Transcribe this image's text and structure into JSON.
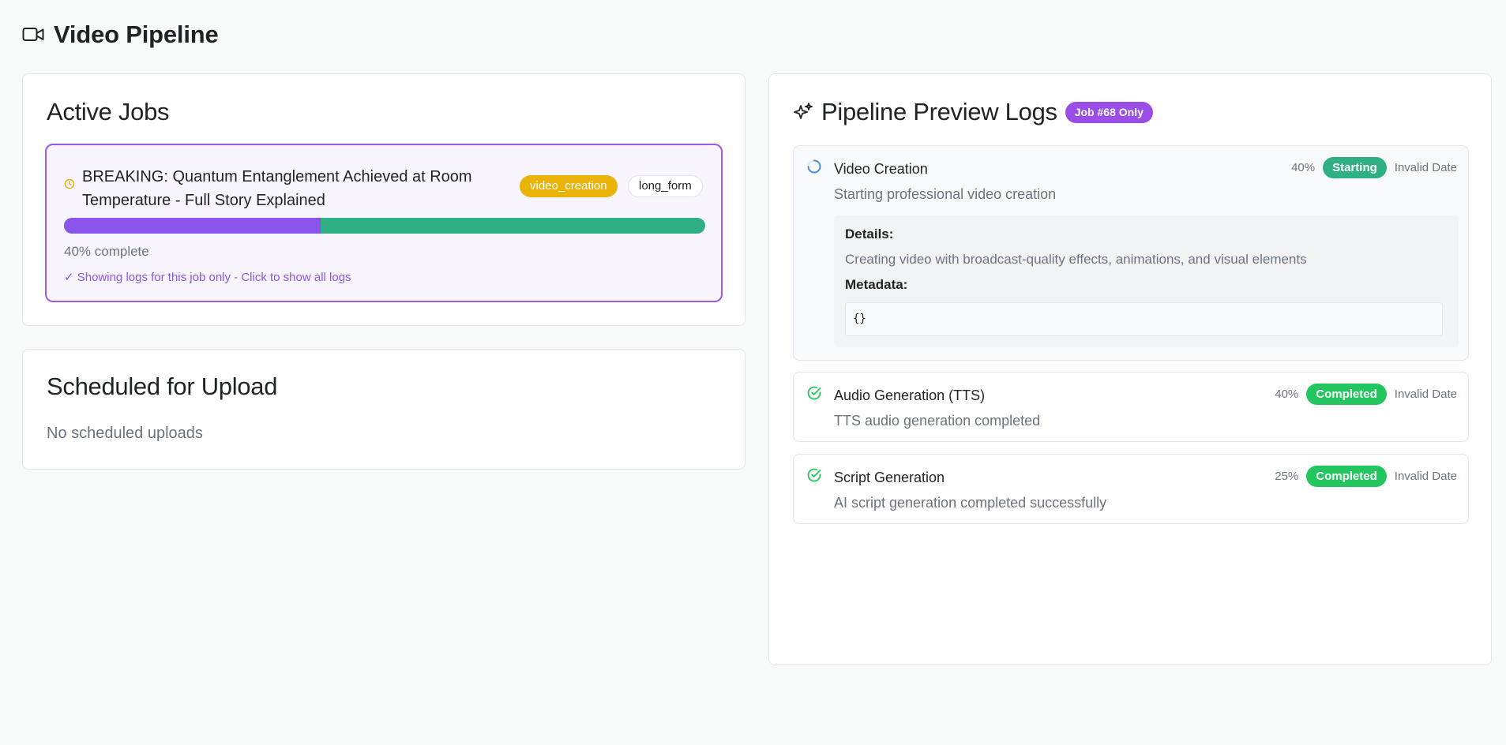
{
  "app": {
    "title": "Video Pipeline",
    "icon": "video-camera-icon"
  },
  "active_jobs": {
    "title": "Active Jobs",
    "job": {
      "title": "BREAKING: Quantum Entanglement Achieved at Room Temperature - Full Story Explained",
      "status": "video_creation",
      "type": "long_form",
      "progress_percent": 40,
      "progress_text": "40% complete",
      "filter_note": "✓ Showing logs for this job only - Click to show all logs",
      "status_icon": "clock-icon",
      "colors": {
        "status_badge": "#eab308",
        "progress_done": "#8b54ea",
        "progress_rest": "#2fb084",
        "selected_border": "#9b59e6"
      }
    }
  },
  "scheduled": {
    "title": "Scheduled for Upload",
    "empty_text": "No scheduled uploads"
  },
  "logs": {
    "title": "Pipeline Preview Logs",
    "icon": "sparkles-icon",
    "filter_badge": "Job #68 Only",
    "entries": [
      {
        "title": "Video Creation",
        "message": "Starting professional video creation",
        "percent": "40%",
        "status": "Starting",
        "date": "Invalid Date",
        "icon": "spinner-icon",
        "status_color": "#2fb084",
        "details_label": "Details:",
        "details": "Creating video with broadcast-quality effects, animations, and visual elements",
        "metadata_label": "Metadata:",
        "metadata": "{}"
      },
      {
        "title": "Audio Generation (TTS)",
        "message": "TTS audio generation completed",
        "percent": "40%",
        "status": "Completed",
        "date": "Invalid Date",
        "icon": "check-circle-icon",
        "status_color": "#22c55e"
      },
      {
        "title": "Script Generation",
        "message": "AI script generation completed successfully",
        "percent": "25%",
        "status": "Completed",
        "date": "Invalid Date",
        "icon": "check-circle-icon",
        "status_color": "#22c55e"
      }
    ]
  }
}
